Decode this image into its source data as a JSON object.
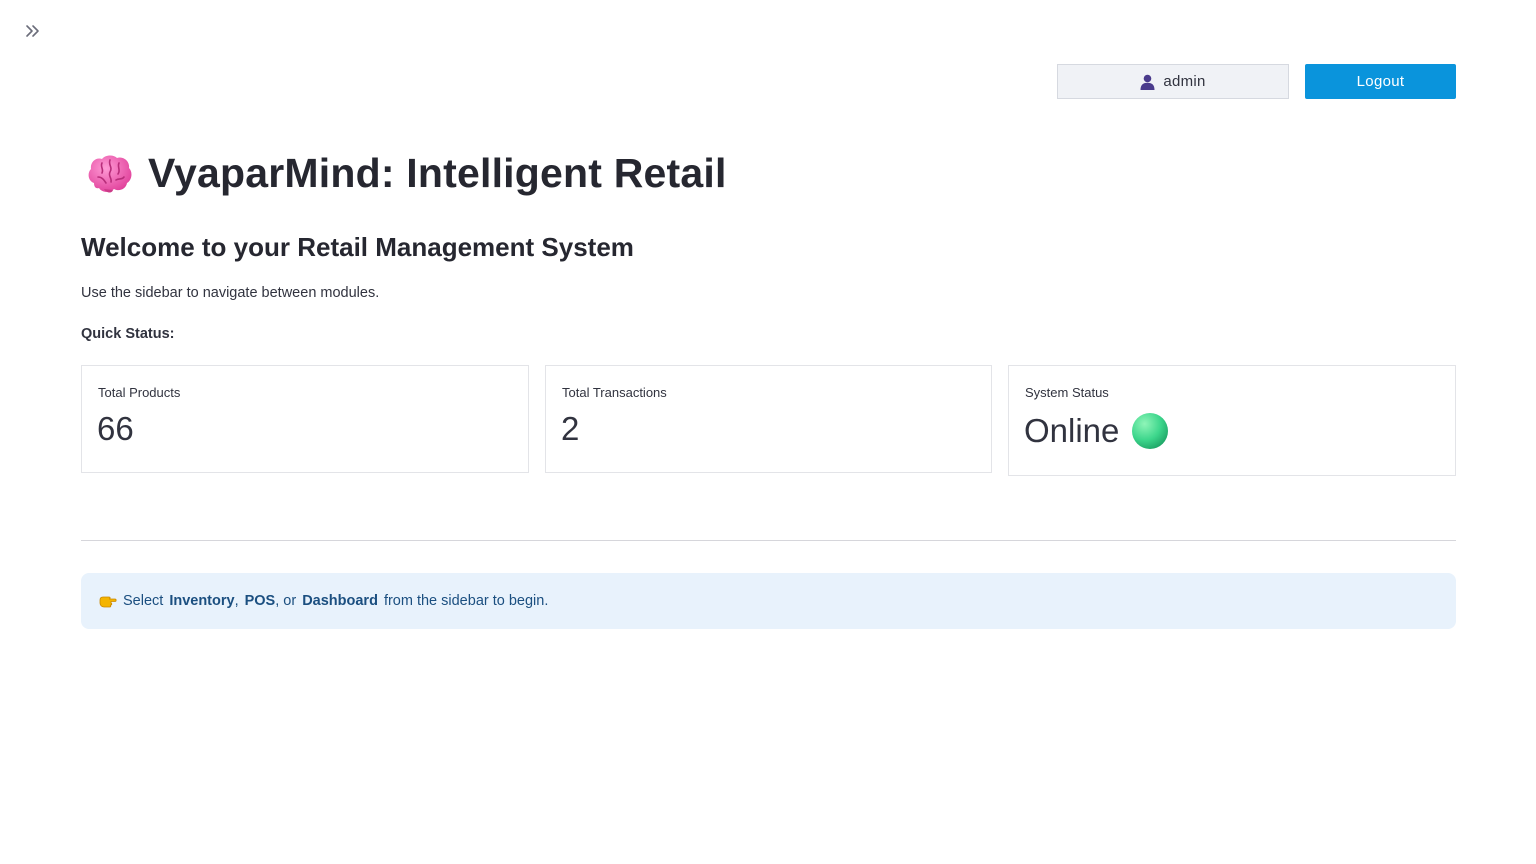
{
  "header": {
    "username": "admin",
    "logout_label": "Logout"
  },
  "main": {
    "title": "VyaparMind: Intelligent Retail",
    "subtitle": "Welcome to your Retail Management System",
    "intro": "Use the sidebar to navigate between modules.",
    "quick_status_label": "Quick Status:",
    "metrics": [
      {
        "label": "Total Products",
        "value": "66"
      },
      {
        "label": "Total Transactions",
        "value": "2"
      },
      {
        "label": "System Status",
        "value": "Online"
      }
    ],
    "info": {
      "prefix": "Select",
      "link1": "Inventory",
      "sep1": ",",
      "link2": "POS",
      "sep2": ", or",
      "link3": "Dashboard",
      "suffix": "from the sidebar to begin."
    }
  },
  "icons": {
    "sidebar_toggle": "double-chevron-right-icon",
    "user": "user-icon",
    "title": "brain-icon",
    "status": "green-circle-icon",
    "info": "pointing-hand-icon"
  },
  "colors": {
    "accent": "#0a94dc",
    "info_bg": "#e8f2fc",
    "info_text": "#1b4f80",
    "status_green": "#3dd68c"
  }
}
